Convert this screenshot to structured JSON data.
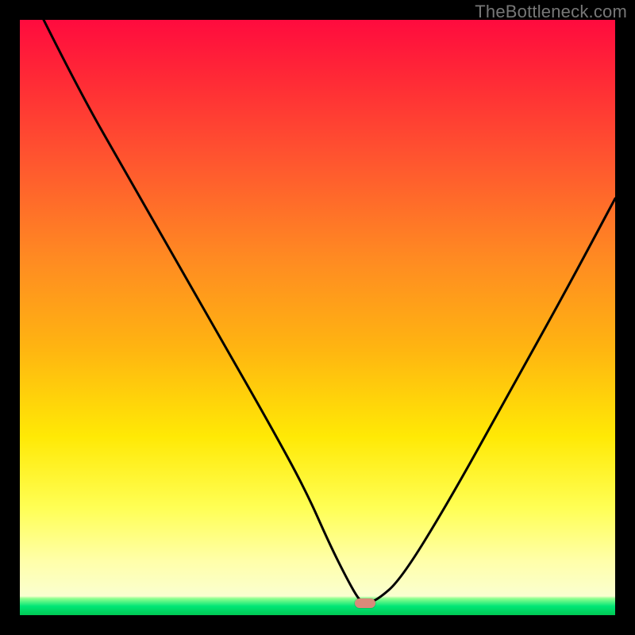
{
  "watermark": "TheBottleneck.com",
  "chart_data": {
    "type": "line",
    "title": "",
    "xlabel": "",
    "ylabel": "",
    "xlim": [
      0,
      100
    ],
    "ylim": [
      0,
      100
    ],
    "grid": false,
    "series": [
      {
        "name": "bottleneck-curve",
        "x": [
          4,
          10,
          18,
          26,
          34,
          42,
          48,
          52,
          55,
          57,
          58,
          60,
          64,
          72,
          82,
          92,
          100
        ],
        "values": [
          100,
          88,
          74,
          60,
          46,
          32,
          21,
          12,
          6,
          2.5,
          2,
          2.5,
          6,
          19,
          37,
          55,
          70
        ]
      }
    ],
    "markers": [
      {
        "name": "optimal-point",
        "x": 58,
        "y": 2
      }
    ],
    "background_gradient": {
      "top": "#ff0b3e",
      "mid": "#ffe905",
      "bottom": "#00c853"
    }
  },
  "marker_color": "#d98a7a"
}
